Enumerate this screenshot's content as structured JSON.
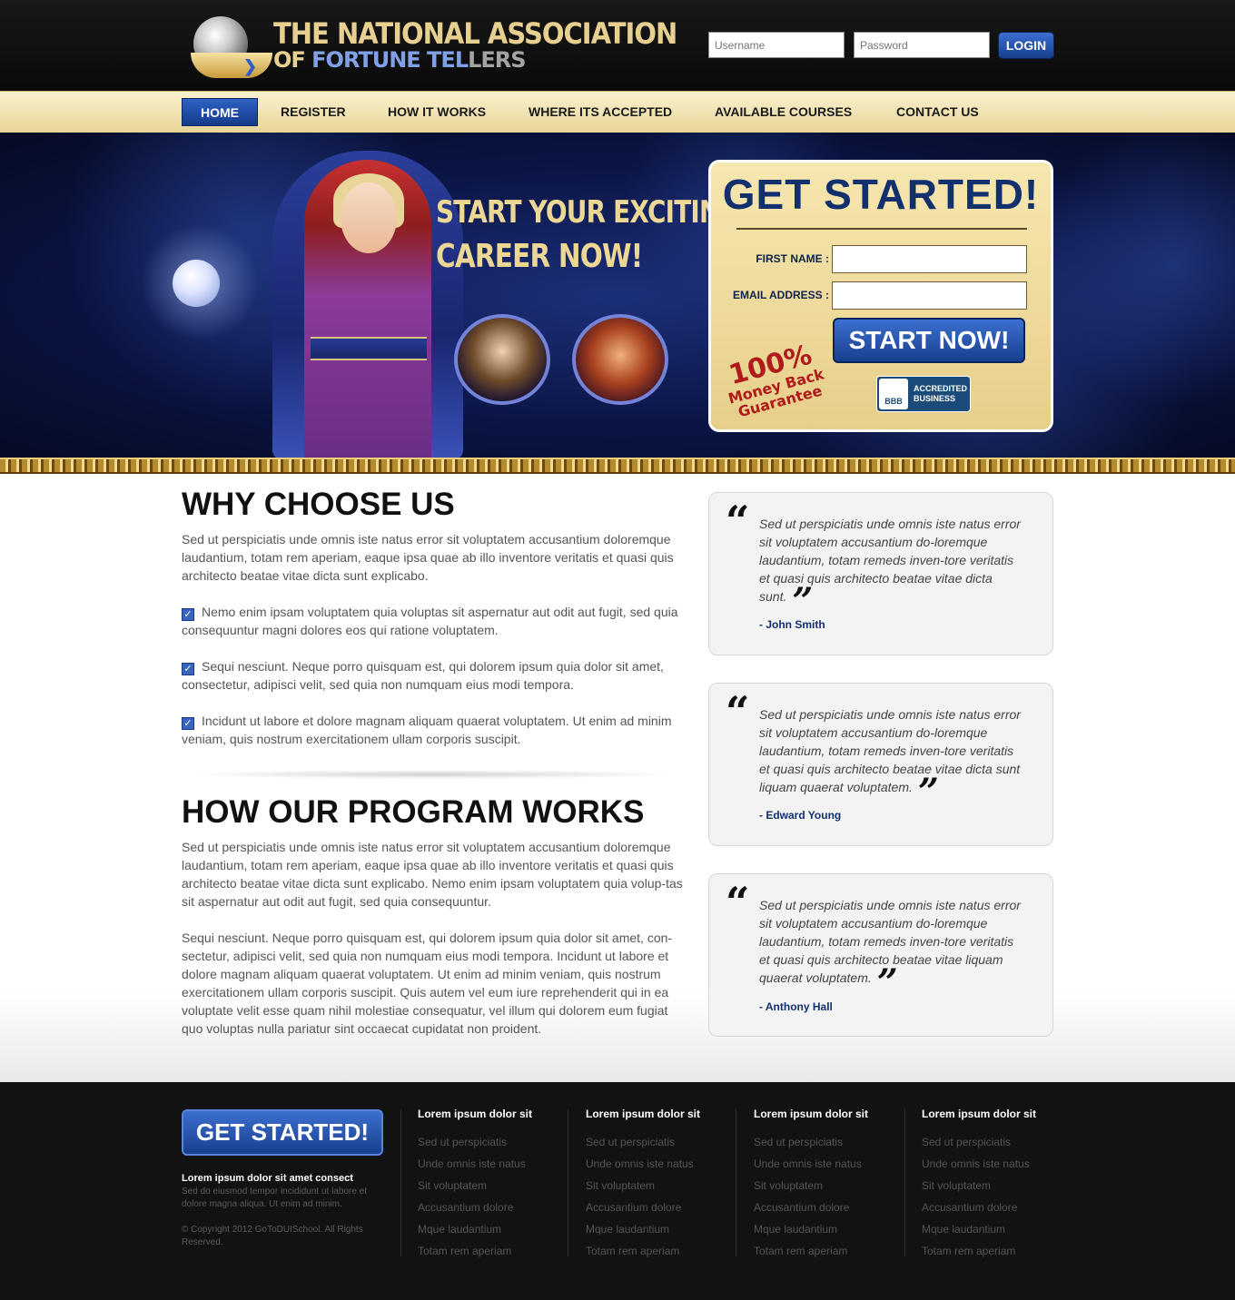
{
  "header": {
    "logo_line1": "THE NATIONAL ASSOCIATION",
    "logo_of": "OF ",
    "logo_fortune": "FORTUNE TEL",
    "logo_lers": "LERS",
    "username_placeholder": "Username",
    "password_placeholder": "Password",
    "login_label": "LOGIN"
  },
  "nav": {
    "items": [
      {
        "label": "HOME"
      },
      {
        "label": "REGISTER"
      },
      {
        "label": "HOW IT WORKS"
      },
      {
        "label": "WHERE ITS ACCEPTED"
      },
      {
        "label": "AVAILABLE COURSES"
      },
      {
        "label": "CONTACT US"
      }
    ]
  },
  "hero": {
    "tagline_1": "START YOUR EXCITING",
    "tagline_2": "CAREER NOW!",
    "form": {
      "title": "GET STARTED!",
      "first_name_label": "FIRST NAME :",
      "email_label": "EMAIL ADDRESS :",
      "first_name_value": "",
      "email_value": "",
      "submit_label": "START NOW!",
      "guarantee_pct": "100%",
      "guarantee_text_1": "Money Back",
      "guarantee_text_2": "Guarantee",
      "bbb_logo": "BBB",
      "bbb_line1": "ACCREDITED",
      "bbb_line2": "BUSINESS"
    }
  },
  "why": {
    "title": "WHY CHOOSE US",
    "intro": "Sed ut perspiciatis unde omnis iste natus error sit voluptatem accusantium doloremque laudantium, totam rem aperiam, eaque ipsa quae ab illo inventore veritatis et quasi quis architecto beatae vitae dicta sunt explicabo.",
    "points": [
      "Nemo enim ipsam voluptatem quia voluptas sit aspernatur aut odit aut fugit, sed quia consequuntur magni dolores eos qui ratione voluptatem.",
      "Sequi nesciunt. Neque porro quisquam est, qui dolorem ipsum quia dolor sit amet, consectetur, adipisci velit, sed quia non numquam eius modi tempora.",
      "Incidunt ut labore et dolore magnam aliquam quaerat voluptatem. Ut enim ad minim veniam, quis nostrum exercitationem ullam corporis suscipit."
    ]
  },
  "how": {
    "title": "HOW OUR PROGRAM WORKS",
    "para1": "Sed ut perspiciatis unde omnis iste natus error sit voluptatem accusantium doloremque laudantium, totam rem aperiam, eaque ipsa quae ab illo inventore veritatis et quasi quis architecto beatae vitae dicta sunt explicabo. Nemo enim ipsam voluptatem quia volup-tas sit aspernatur aut odit aut fugit, sed quia consequuntur.",
    "para2": "Sequi nesciunt. Neque porro quisquam est, qui dolorem ipsum quia dolor sit amet, con-sectetur, adipisci velit, sed quia non numquam eius modi tempora. Incidunt ut labore et dolore magnam aliquam quaerat voluptatem. Ut enim ad minim veniam, quis nostrum exercitationem ullam corporis suscipit. Quis autem vel eum iure reprehenderit qui in ea voluptate velit esse quam nihil molestiae consequatur, vel illum qui dolorem eum fugiat quo voluptas nulla pariatur sint occaecat cupidatat non proident."
  },
  "testimonials": [
    {
      "quote": "Sed ut perspiciatis unde omnis iste natus error sit voluptatem accusantium do-loremque laudantium, totam remeds inven-tore veritatis et quasi quis architecto beatae vitae dicta sunt.",
      "author": "- John Smith"
    },
    {
      "quote": "Sed ut perspiciatis unde omnis iste natus error sit voluptatem accusantium do-loremque laudantium, totam remeds inven-tore veritatis et quasi quis architecto beatae vitae dicta sunt liquam quaerat voluptatem.",
      "author": "- Edward Young"
    },
    {
      "quote": "Sed ut perspiciatis unde omnis iste natus error sit voluptatem accusantium do-loremque laudantium, totam remeds inven-tore veritatis et quasi quis architecto beatae vitae liquam quaerat voluptatem.",
      "author": "- Anthony Hall"
    }
  ],
  "footer": {
    "cta_label": "GET STARTED!",
    "about_heading": "Lorem ipsum dolor sit amet consect",
    "about_text": "Sed do eiusmod tempor incididunt ut labore et dolore magna aliqua. Ut enim ad minim.",
    "copyright": "© Copyright 2012 GoToDUISchool. All Rights Reserved.",
    "columns": [
      {
        "heading": "Lorem ipsum dolor sit",
        "links": [
          "Sed ut perspiciatis",
          "Unde omnis iste natus",
          "Sit voluptatem",
          "Accusantium dolore",
          "Mque laudantium",
          "Totam rem aperiam"
        ]
      },
      {
        "heading": "Lorem ipsum dolor sit",
        "links": [
          "Sed ut perspiciatis",
          "Unde omnis iste natus",
          "Sit voluptatem",
          "Accusantium dolore",
          "Mque laudantium",
          "Totam rem aperiam"
        ]
      },
      {
        "heading": "Lorem ipsum dolor sit",
        "links": [
          "Sed ut perspiciatis",
          "Unde omnis iste natus",
          "Sit voluptatem",
          "Accusantium dolore",
          "Mque laudantium",
          "Totam rem aperiam"
        ]
      },
      {
        "heading": "Lorem ipsum dolor sit",
        "links": [
          "Sed ut perspiciatis",
          "Unde omnis iste natus",
          "Sit voluptatem",
          "Accusantium dolore",
          "Mque laudantium",
          "Totam rem aperiam"
        ]
      }
    ]
  }
}
